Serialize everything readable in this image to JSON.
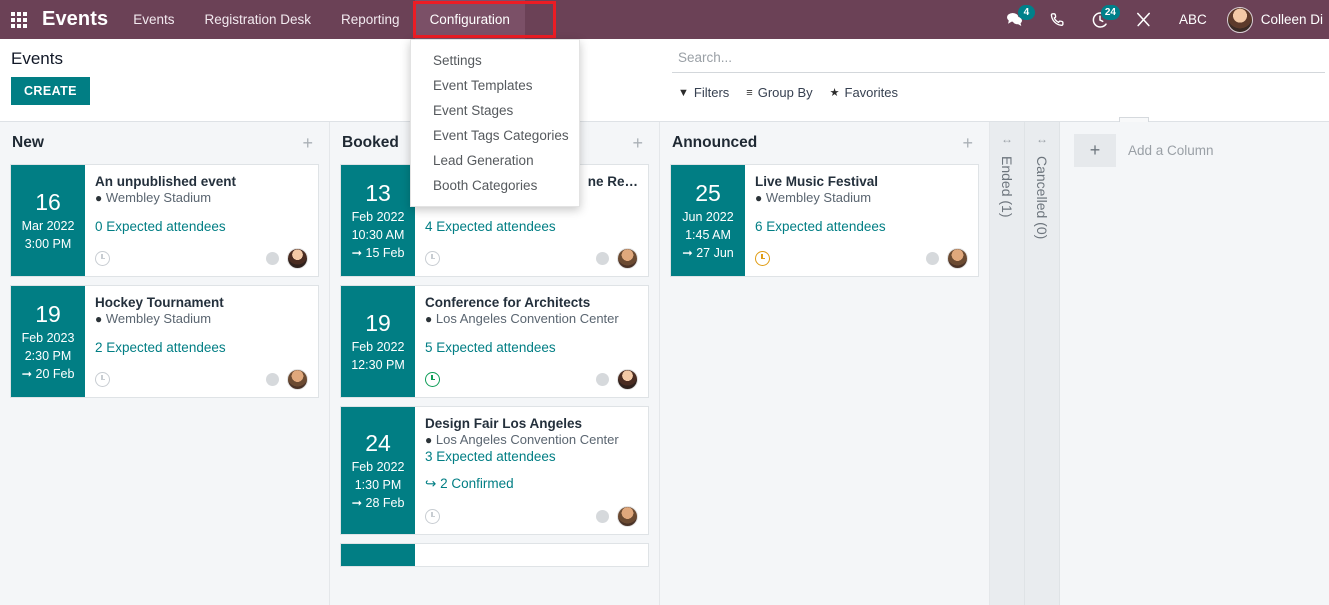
{
  "navbar": {
    "apps_icon": "apps-grid-icon",
    "brand": "Events",
    "menus": [
      {
        "label": "Events",
        "active": false
      },
      {
        "label": "Registration Desk",
        "active": false
      },
      {
        "label": "Reporting",
        "active": false
      },
      {
        "label": "Configuration",
        "active": true
      }
    ],
    "systray": {
      "messages_icon": "messages-icon",
      "messages_count": "4",
      "phone_icon": "phone-icon",
      "activities_icon": "activities-clock-icon",
      "activities_count": "24",
      "tools_icon": "tools-icon",
      "debug_label": "ABC",
      "avatar_icon": "user-avatar",
      "user_name": "Colleen Di"
    },
    "highlight_color": "#ec1c24",
    "background_color": "#6b4156"
  },
  "configuration_menu": {
    "items": [
      {
        "label": "Settings"
      },
      {
        "label": "Event Templates"
      },
      {
        "label": "Event Stages"
      },
      {
        "label": "Event Tags Categories"
      },
      {
        "label": "Lead Generation"
      },
      {
        "label": "Booth Categories"
      }
    ]
  },
  "control_panel": {
    "breadcrumb": "Events",
    "create_label": "CREATE",
    "search": {
      "placeholder": "Search...",
      "value": "",
      "icon": "search-icon"
    },
    "filters": [
      {
        "label": "Filters",
        "icon": "filter-funnel-icon"
      },
      {
        "label": "Group By",
        "icon": "group-by-icon"
      },
      {
        "label": "Favorites",
        "icon": "star-icon"
      }
    ],
    "views": [
      {
        "name": "kanban-view",
        "icon": "kanban-icon",
        "active": true
      },
      {
        "name": "calendar-view",
        "icon": "calendar-icon",
        "active": false
      },
      {
        "name": "list-view",
        "icon": "list-icon",
        "active": false
      },
      {
        "name": "gantt-view",
        "icon": "gantt-icon",
        "active": false
      },
      {
        "name": "pivot-view",
        "icon": "pivot-icon",
        "active": false
      },
      {
        "name": "graph-view",
        "icon": "graph-icon",
        "active": false
      },
      {
        "name": "map-view",
        "icon": "map-pin-icon",
        "active": false
      }
    ]
  },
  "board": {
    "add_column_label": "Add a Column",
    "columns": [
      {
        "title": "New",
        "add_icon": "plus-icon",
        "cards": [
          {
            "day": "16",
            "month_year": "Mar 2022",
            "time": "3:00 PM",
            "end": "",
            "title": "An unpublished event",
            "location": "Wembley Stadium",
            "attendees": "0 Expected attendees",
            "confirmed": "",
            "activity_state": "none",
            "avatar": "female"
          },
          {
            "day": "19",
            "month_year": "Feb 2023",
            "time": "2:30 PM",
            "end": "20 Feb",
            "title": "Hockey Tournament",
            "location": "Wembley Stadium",
            "attendees": "2 Expected attendees",
            "confirmed": "",
            "activity_state": "none",
            "avatar": "male"
          }
        ]
      },
      {
        "title": "Booked",
        "add_icon": "plus-icon",
        "cards": [
          {
            "day": "13",
            "month_year": "Feb 2022",
            "time": "10:30 AM",
            "end": "15 Feb",
            "title": "ne Re…",
            "location": "",
            "attendees": "4 Expected attendees",
            "confirmed": "",
            "activity_state": "none",
            "avatar": "male"
          },
          {
            "day": "19",
            "month_year": "Feb 2022",
            "time": "12:30 PM",
            "end": "",
            "title": "Conference for Architects",
            "location": "Los Angeles Convention Center",
            "attendees": "5 Expected attendees",
            "confirmed": "",
            "activity_state": "green",
            "avatar": "female"
          },
          {
            "day": "24",
            "month_year": "Feb 2022",
            "time": "1:30 PM",
            "end": "28 Feb",
            "title": "Design Fair Los Angeles",
            "location": "Los Angeles Convention Center",
            "attendees": "3 Expected attendees",
            "confirmed": "2 Confirmed",
            "activity_state": "none",
            "avatar": "male"
          }
        ]
      },
      {
        "title": "Announced",
        "add_icon": "plus-icon",
        "cards": [
          {
            "day": "25",
            "month_year": "Jun 2022",
            "time": "1:45 AM",
            "end": "27 Jun",
            "title": "Live Music Festival",
            "location": "Wembley Stadium",
            "attendees": "6 Expected attendees",
            "confirmed": "",
            "activity_state": "orange",
            "avatar": "male"
          }
        ]
      }
    ],
    "folded_columns": [
      {
        "label": "Ended (1)"
      },
      {
        "label": "Cancelled (0)"
      }
    ]
  }
}
